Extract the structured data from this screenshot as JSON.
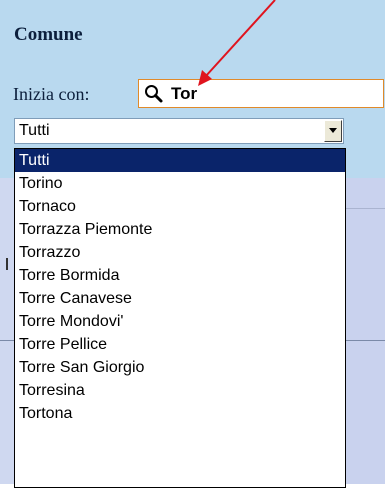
{
  "panel": {
    "title": "Comune",
    "filter_label": "Inizia con:",
    "search_value": "Tor",
    "search_placeholder": ""
  },
  "select": {
    "value": "Tutti"
  },
  "dropdown": {
    "options": [
      {
        "label": "Tutti",
        "selected": true
      },
      {
        "label": "Torino",
        "selected": false
      },
      {
        "label": "Tornaco",
        "selected": false
      },
      {
        "label": "Torrazza Piemonte",
        "selected": false
      },
      {
        "label": "Torrazzo",
        "selected": false
      },
      {
        "label": "Torre Bormida",
        "selected": false
      },
      {
        "label": "Torre Canavese",
        "selected": false
      },
      {
        "label": "Torre Mondovi'",
        "selected": false
      },
      {
        "label": "Torre Pellice",
        "selected": false
      },
      {
        "label": "Torre San Giorgio",
        "selected": false
      },
      {
        "label": "Torresina",
        "selected": false
      },
      {
        "label": "Tortona",
        "selected": false
      }
    ]
  },
  "colors": {
    "panel_bg": "#b9d9ef",
    "selected_bg": "#0a246a",
    "search_border": "#e08a2a",
    "annotation_arrow": "#e0141e"
  },
  "icons": {
    "search": "search-icon",
    "dropdown_arrow": "chevron-down-icon",
    "annotation": "arrow-annotation-icon"
  }
}
